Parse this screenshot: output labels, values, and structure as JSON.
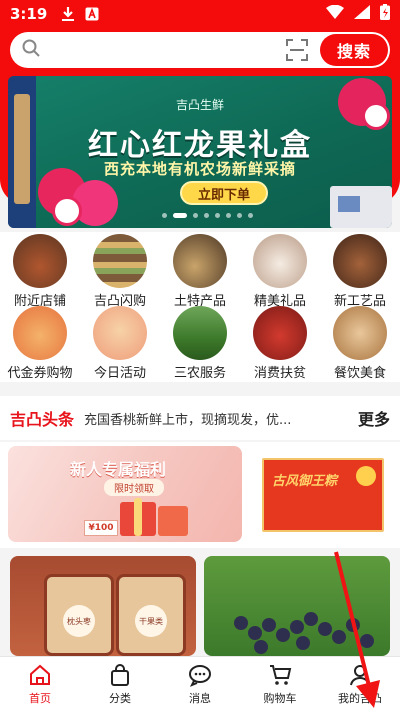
{
  "status_bar": {
    "time": "3:19"
  },
  "search": {
    "placeholder": "",
    "button_label": "搜索"
  },
  "banner": {
    "brand": "吉凸生鲜",
    "title": "红心红龙果礼盒",
    "subtitle": "西充本地有机农场新鲜采摘",
    "cta": "立即下单",
    "slide_count": 8,
    "active_slide": 1
  },
  "categories": [
    {
      "label": "附近店铺",
      "icon": "store-icon"
    },
    {
      "label": "吉凸闪购",
      "icon": "shelf-icon"
    },
    {
      "label": "土特产品",
      "icon": "specialty-icon"
    },
    {
      "label": "精美礼品",
      "icon": "gift-icon"
    },
    {
      "label": "新工艺品",
      "icon": "craft-icon"
    },
    {
      "label": "代金券购物",
      "icon": "voucher-icon"
    },
    {
      "label": "今日活动",
      "icon": "balloon-icon"
    },
    {
      "label": "三农服务",
      "icon": "field-icon"
    },
    {
      "label": "消费扶贫",
      "icon": "package-icon"
    },
    {
      "label": "餐饮美食",
      "icon": "coffee-icon"
    }
  ],
  "headlines": {
    "tag": "吉凸头条",
    "text": "充国香桃新鲜上市，现摘现发，优...",
    "more": "更多"
  },
  "promo": {
    "title": "新人专属福利",
    "sub": "限时领取",
    "ticket": "¥100",
    "product_text": "古风御王粽"
  },
  "cards": {
    "jar_label_1": "枕头枣",
    "jar_label_2": "干果类"
  },
  "tabbar": [
    {
      "label": "首页",
      "icon": "home-icon",
      "active": true
    },
    {
      "label": "分类",
      "icon": "bag-icon",
      "active": false
    },
    {
      "label": "消息",
      "icon": "message-icon",
      "active": false
    },
    {
      "label": "购物车",
      "icon": "cart-icon",
      "active": false
    },
    {
      "label": "我的吉凸",
      "icon": "user-icon",
      "active": false
    }
  ],
  "colors": {
    "brand_red": "#f40b0b",
    "banner_green": "#127a62",
    "white": "#ffffff"
  }
}
